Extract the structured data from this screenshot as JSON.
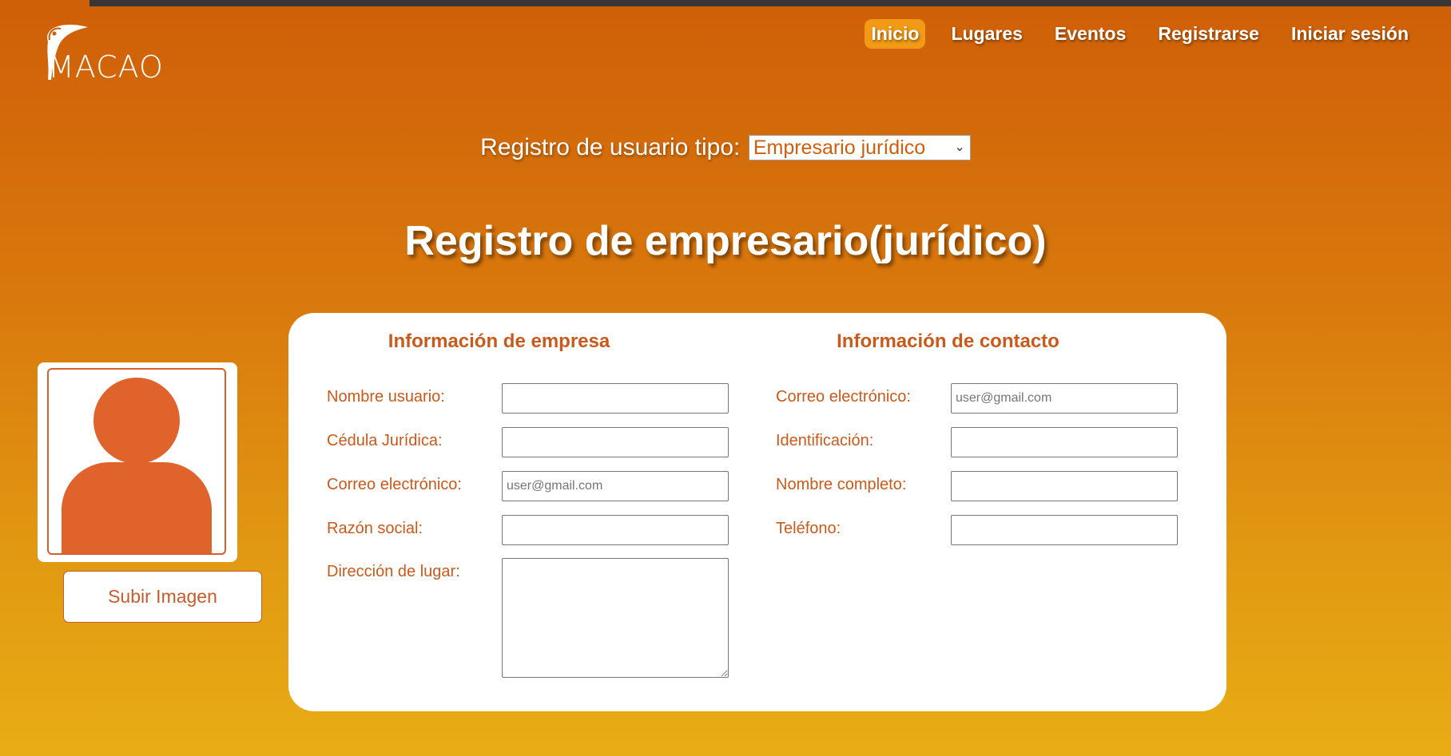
{
  "brand": {
    "name": "MACAO",
    "logo_icon": "parrot-icon"
  },
  "nav": {
    "items": [
      {
        "label": "Inicio",
        "active": true
      },
      {
        "label": "Lugares",
        "active": false
      },
      {
        "label": "Eventos",
        "active": false
      },
      {
        "label": "Registrarse",
        "active": false
      },
      {
        "label": "Iniciar sesión",
        "active": false
      }
    ]
  },
  "user_type": {
    "label": "Registro de usuario tipo:",
    "selected": "Empresario jurídico"
  },
  "page_title": "Registro de empresario(jurídico)",
  "avatar": {
    "icon": "user-silhouette-icon",
    "upload_label": "Subir Imagen"
  },
  "company_info": {
    "title": "Información de empresa",
    "fields": [
      {
        "label": "Nombre usuario:",
        "value": "",
        "placeholder": ""
      },
      {
        "label": "Cédula Jurídica:",
        "value": "",
        "placeholder": ""
      },
      {
        "label": "Correo electrónico:",
        "value": "",
        "placeholder": "user@gmail.com"
      },
      {
        "label": "Razón social:",
        "value": "",
        "placeholder": ""
      },
      {
        "label": "Dirección de lugar:",
        "value": "",
        "placeholder": ""
      }
    ]
  },
  "contact_info": {
    "title": "Información de contacto",
    "fields": [
      {
        "label": "Correo electrónico:",
        "value": "",
        "placeholder": "user@gmail.com"
      },
      {
        "label": "Identificación:",
        "value": "",
        "placeholder": ""
      },
      {
        "label": "Nombre completo:",
        "value": "",
        "placeholder": ""
      },
      {
        "label": "Teléfono:",
        "value": "",
        "placeholder": ""
      }
    ]
  },
  "colors": {
    "accent": "#c95a1b",
    "active_nav": "#f29a16",
    "avatar": "#df632b"
  }
}
